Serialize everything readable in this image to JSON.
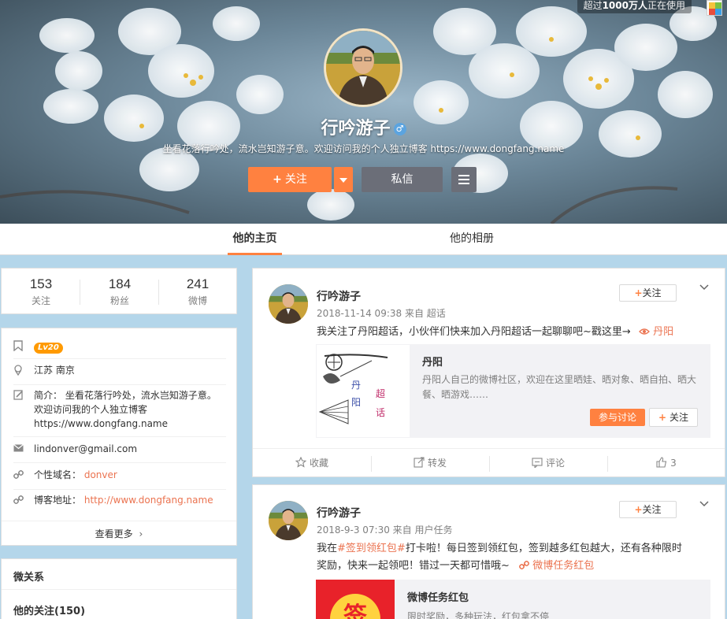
{
  "cover": {
    "online_prefix": "超过",
    "online_count": "1000万人",
    "online_suffix": "正在使用",
    "nickname": "行吟游子",
    "gender_icon": "male-icon",
    "bio": "坐看花落行吟处，流水岂知游子意。欢迎访问我的个人独立博客 https://www.dongfang.name",
    "follow_label": "关注",
    "message_label": "私信"
  },
  "tabs": [
    "他的主页",
    "他的相册"
  ],
  "counts": [
    {
      "value": "153",
      "label": "关注"
    },
    {
      "value": "184",
      "label": "粉丝"
    },
    {
      "value": "241",
      "label": "微博"
    }
  ],
  "info": {
    "level": "Lv20",
    "location": "江苏 南京",
    "intro_line1": "简介： 坐看花落行吟处，流水岂知游子意。",
    "intro_line2": "欢迎访问我的个人独立博客",
    "intro_line3": "https://www.dongfang.name",
    "email": "lindonver@gmail.com",
    "domain_label": "个性域名：",
    "domain_value": "donver",
    "blog_label": "博客地址：",
    "blog_value": "http://www.dongfang.name",
    "see_more": "查看更多"
  },
  "relations": {
    "title": "微关系",
    "following": "他的关注(150)"
  },
  "posts": [
    {
      "author": "行吟游子",
      "meta": "2018-11-14 09:38 来自 超话",
      "follow_label": "关注",
      "text": "我关注了丹阳超话，小伙伴们快来加入丹阳超话一起聊聊吧~戳这里→",
      "link": "丹阳",
      "topic": {
        "title": "丹阳",
        "desc": "丹阳人自己的微博社区，欢迎在这里晒娃、晒对象、晒自拍、晒大餐、晒游戏……",
        "join_label": "参与讨论",
        "follow_label": "关注",
        "img_text_1": "丹",
        "img_text_2": "阳",
        "img_text_3": "超",
        "img_text_4": "话"
      },
      "actions": {
        "fav": "收藏",
        "repost": "转发",
        "comment": "评论",
        "like": "3"
      }
    },
    {
      "author": "行吟游子",
      "meta": "2018-9-3 07:30 来自 用户任务",
      "follow_label": "关注",
      "text_prefix": "我在",
      "hashtag": "#签到领红包#",
      "text_line1": "打卡啦！每日签到领红包，签到越多红包越大，还有各种限时",
      "text_line2": "奖励，快来一起领吧！错过一天都可惜哦~",
      "link": "微博任务红包",
      "card": {
        "title": "微博任务红包",
        "desc": "限时奖励，多种玩法，红包拿不停",
        "coin": "签"
      }
    }
  ],
  "colors": {
    "accent": "#ff8140",
    "link": "#eb7350",
    "page_bg": "#b4d6ea"
  }
}
